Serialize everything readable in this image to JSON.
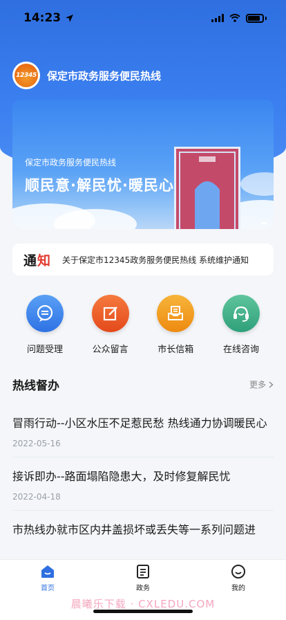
{
  "status": {
    "time": "14:23"
  },
  "header": {
    "logo_text": "12345",
    "title": "保定市政务服务便民热线"
  },
  "banner": {
    "subtitle": "保定市政务服务便民热线",
    "headline": "顺民意·解民忧·暖民心"
  },
  "notice": {
    "tag": "通知",
    "text": "关于保定市12345政务服务便民热线 系统维护通知"
  },
  "quick_actions": [
    {
      "label": "问题受理",
      "color": "#3a82ea",
      "icon": "chat-icon"
    },
    {
      "label": "公众留言",
      "color": "#eb5a24",
      "icon": "edit-icon"
    },
    {
      "label": "市长信箱",
      "color": "#f19b1f",
      "icon": "mailbox-icon"
    },
    {
      "label": "在线咨询",
      "color": "#43b38a",
      "icon": "headset-icon"
    }
  ],
  "section": {
    "title": "热线督办",
    "more": "更多"
  },
  "news": [
    {
      "title": "冒雨行动--小区水压不足惹民愁 热线通力协调暖民心",
      "date": "2022-05-16"
    },
    {
      "title": "接诉即办--路面塌陷隐患大，及时修复解民忧",
      "date": "2022-04-18"
    },
    {
      "title": "市热线办就市区内井盖损坏或丢失等一系列问题进",
      "date": ""
    }
  ],
  "tabs": [
    {
      "label": "首页",
      "icon": "home-icon",
      "active": true
    },
    {
      "label": "政务",
      "icon": "document-icon",
      "active": false
    },
    {
      "label": "我的",
      "icon": "smile-icon",
      "active": false
    }
  ],
  "watermark": "晨曦乐下载 · CXLEDU.COM",
  "colors": {
    "primary": "#2f6fe0",
    "notice_accent": "#e23a2e"
  }
}
